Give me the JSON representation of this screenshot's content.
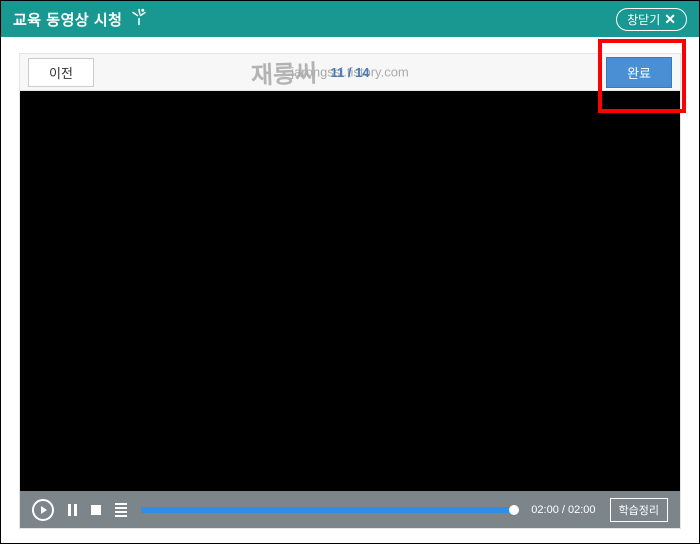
{
  "header": {
    "title": "교육 동영상 시청",
    "close_label": "창닫기"
  },
  "toolbar": {
    "prev_label": "이전",
    "page_current": "11",
    "page_divider": " / ",
    "page_total": "14",
    "complete_label": "완료"
  },
  "watermark": {
    "url": "jarongssi.tistory.com",
    "text": "재롱씨"
  },
  "controls": {
    "time_current": "02:00",
    "time_separator": " / ",
    "time_total": "02:00",
    "summary_label": "학습정리",
    "progress_percent": 100
  }
}
